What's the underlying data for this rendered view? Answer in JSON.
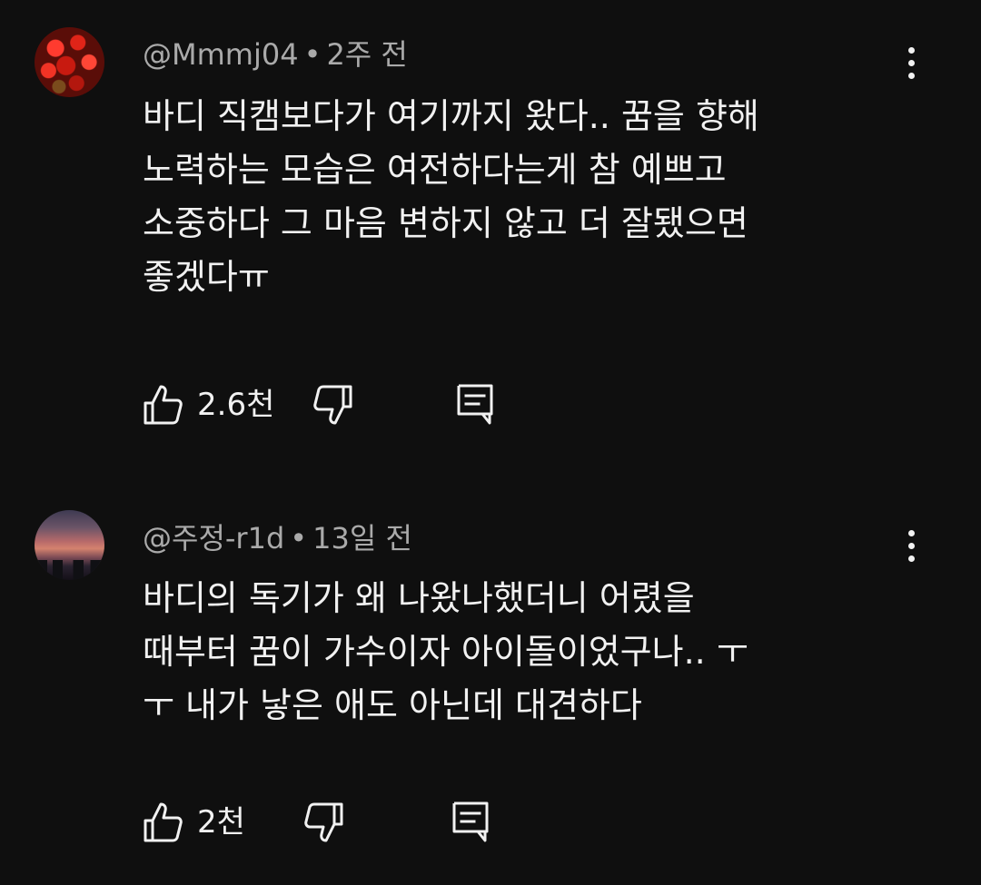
{
  "comments": [
    {
      "handle": "@Mmmj04",
      "separator": "•",
      "time": "2주 전",
      "lines": [
        "바디 직캠보다가 여기까지 왔다.. 꿈을 향해",
        "노력하는 모습은 여전하다는게 참 예쁘고",
        "소중하다 그 마음 변하지 않고 더 잘됐으면",
        "좋겠다ㅠ"
      ],
      "like_count": "2.6천",
      "avatar_icon": "red-flowers-avatar"
    },
    {
      "handle": "@주정-r1d",
      "separator": "•",
      "time": "13일 전",
      "lines": [
        "바디의 독기가 왜 나왔나했더니 어렸을",
        "때부터 꿈이 가수이자 아이돌이었구나.. ㅜ",
        "ㅜ 내가 낳은 애도 아닌데 대견하다"
      ],
      "like_count": "2천",
      "avatar_icon": "sunset-avatar"
    }
  ],
  "icons": {
    "like": "thumbs-up-icon",
    "dislike": "thumbs-down-icon",
    "reply": "reply-comment-icon",
    "more": "more-vertical-icon"
  },
  "colors": {
    "background": "#0f0f0f",
    "text": "#f1f1f1",
    "meta": "#aaaaaa"
  }
}
